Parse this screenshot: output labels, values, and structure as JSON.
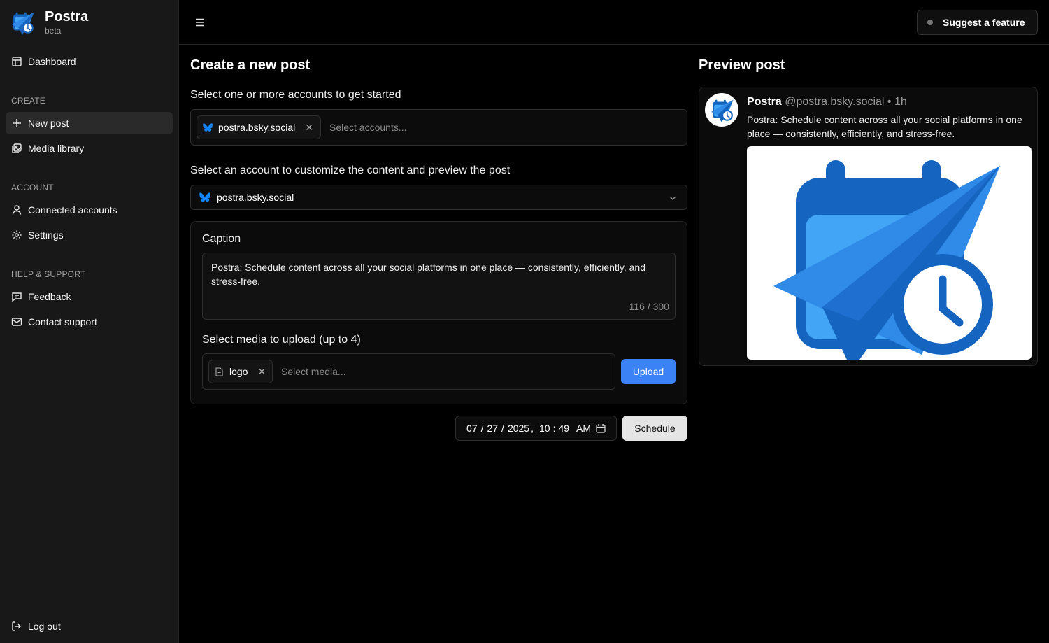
{
  "brand": {
    "name": "Postra",
    "tag": "beta"
  },
  "sidebar": {
    "dashboard": "Dashboard",
    "sections": {
      "create": "CREATE",
      "account": "ACCOUNT",
      "help": "HELP & SUPPORT"
    },
    "items": {
      "new_post": "New post",
      "media_library": "Media library",
      "connected_accounts": "Connected accounts",
      "settings": "Settings",
      "feedback": "Feedback",
      "contact_support": "Contact support"
    },
    "logout": "Log out"
  },
  "header": {
    "suggest": "Suggest a feature"
  },
  "compose": {
    "title": "Create a new post",
    "accounts_label": "Select one or more accounts to get started",
    "selected_account": "postra.bsky.social",
    "accounts_placeholder": "Select accounts...",
    "customize_label": "Select an account to customize the content and preview the post",
    "customize_value": "postra.bsky.social",
    "caption_label": "Caption",
    "caption_text": "Postra: Schedule content across all your social platforms in one place — consistently, efficiently, and stress-free.",
    "caption_count": "116 / 300",
    "media_label": "Select media to upload (up to 4)",
    "media_chip": "logo",
    "media_placeholder": "Select media...",
    "upload_label": "Upload",
    "date": {
      "month": "07",
      "day": "27",
      "year": "2025",
      "hour": "10",
      "minute": "49",
      "ampm": "AM"
    },
    "schedule_label": "Schedule"
  },
  "preview": {
    "title": "Preview post",
    "name": "Postra",
    "handle": "@postra.bsky.social",
    "time": "• 1h",
    "text": "Postra: Schedule content across all your social platforms in one place — consistently, efficiently, and stress-free."
  },
  "colors": {
    "accent": "#3b82f6",
    "bluesky": "#1185fe",
    "logo_dark": "#1565c0",
    "logo_light": "#42a5f5"
  }
}
